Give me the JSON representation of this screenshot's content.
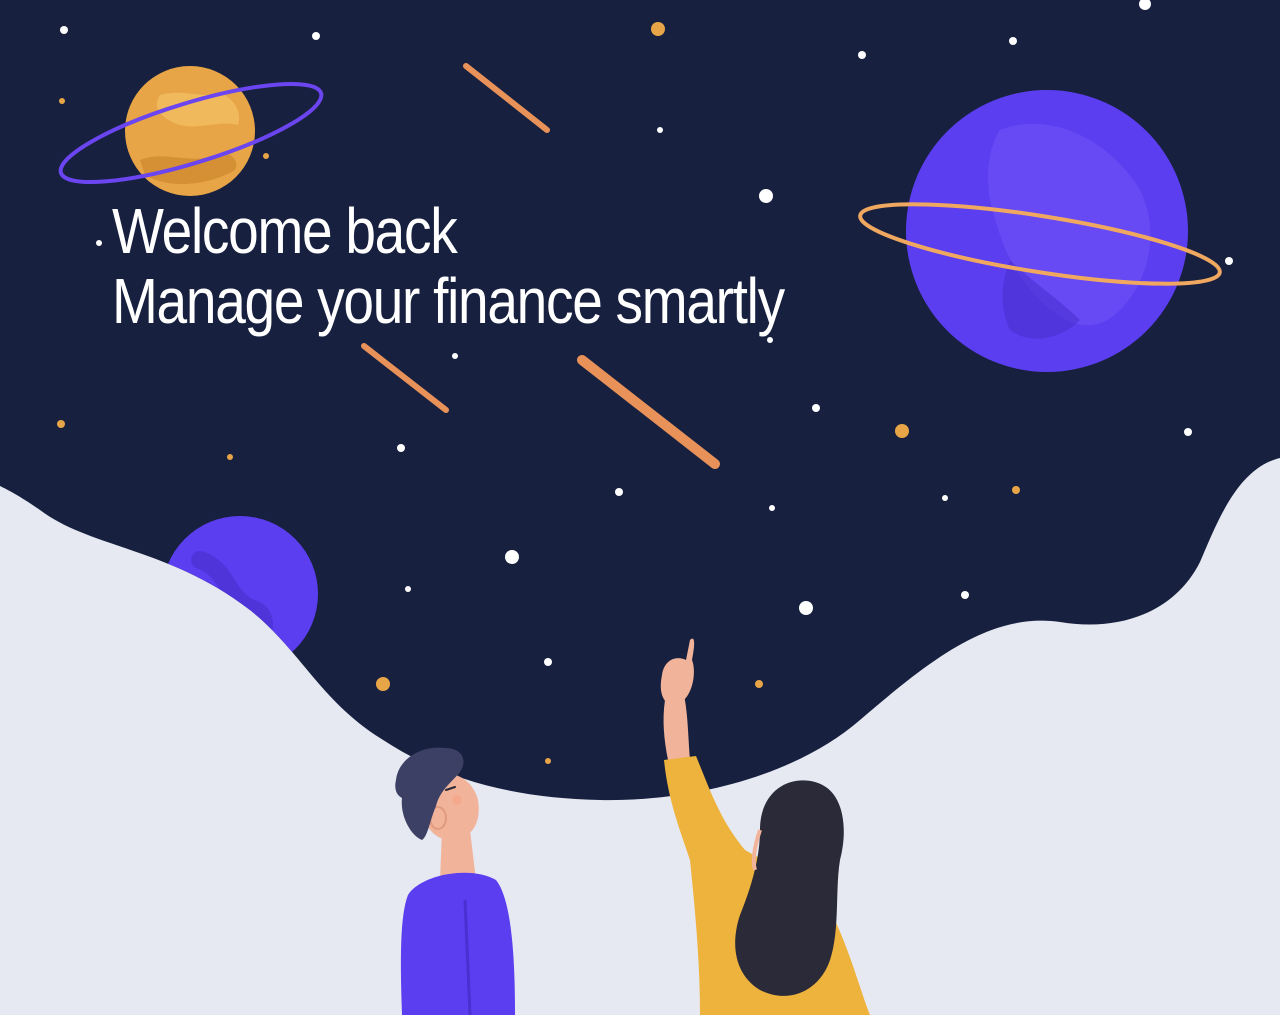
{
  "hero": {
    "title": "Welcome back",
    "subtitle": "Manage your finance smartly"
  },
  "colors": {
    "night_sky": "#18203f",
    "ground": "#e6e9f2",
    "planet_purple": "#5b3ef0",
    "planet_orange": "#e8a547",
    "meteor": "#f0a050",
    "shirt_purple": "#5b3ef0",
    "shirt_yellow": "#eeb33d",
    "hair": "#2b2a38",
    "text": "#ffffff"
  },
  "illustration": {
    "elements": [
      "night-sky",
      "ringed-planet-orange",
      "ringed-planet-purple",
      "small-planet-purple",
      "meteors",
      "stars",
      "man",
      "woman-pointing"
    ]
  }
}
